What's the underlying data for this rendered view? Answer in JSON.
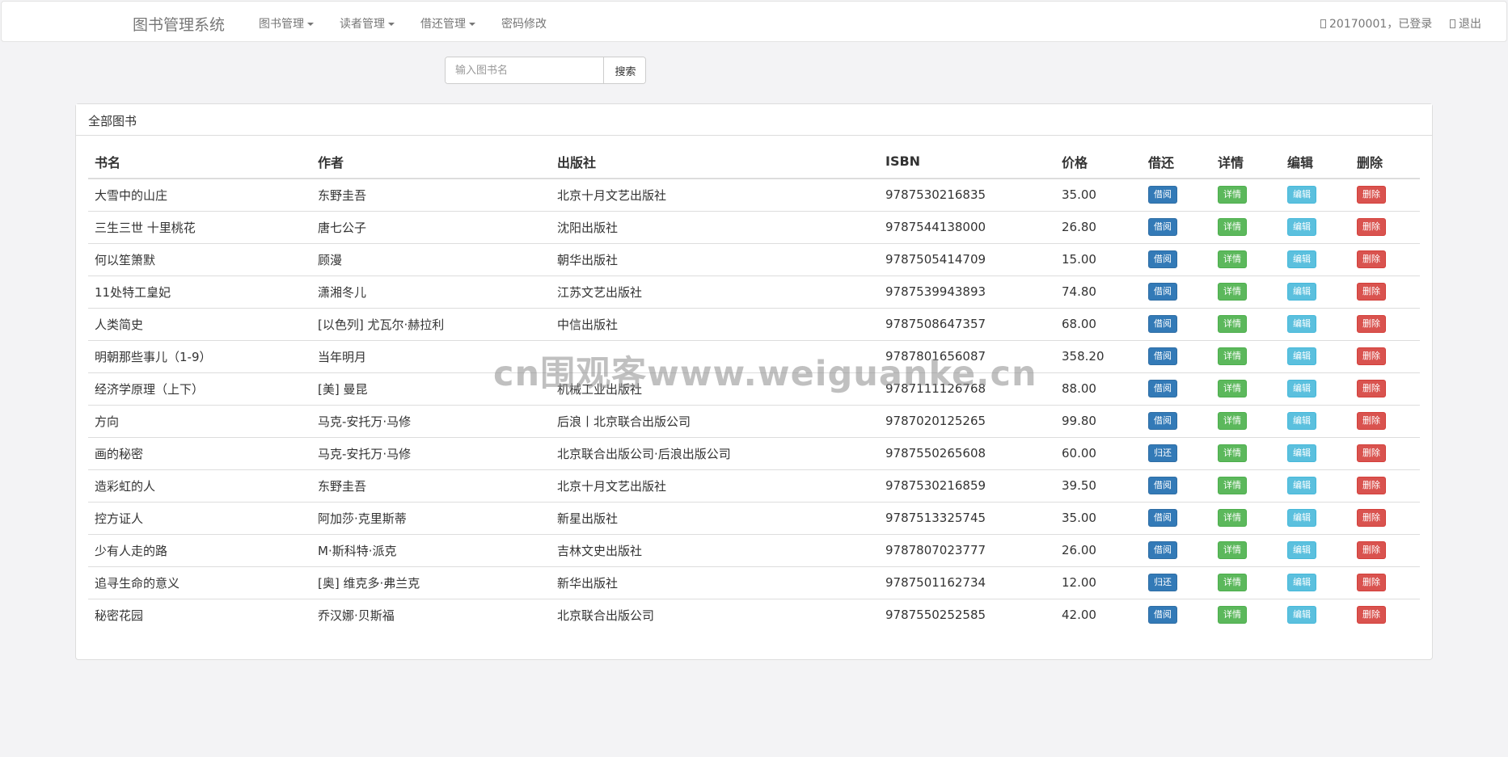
{
  "nav": {
    "brand": "图书管理系统",
    "items": [
      {
        "label": "图书管理",
        "dropdown": true
      },
      {
        "label": "读者管理",
        "dropdown": true
      },
      {
        "label": "借还管理",
        "dropdown": true
      },
      {
        "label": "密码修改",
        "dropdown": false
      }
    ],
    "user": "20170001，已登录",
    "logout": "退出"
  },
  "search": {
    "placeholder": "输入图书名",
    "button": "搜索"
  },
  "panel": {
    "title": "全部图书"
  },
  "table": {
    "headers": [
      "书名",
      "作者",
      "出版社",
      "ISBN",
      "价格",
      "借还",
      "详情",
      "编辑",
      "删除"
    ],
    "rows": [
      {
        "name": "大雪中的山庄",
        "author": "东野圭吾",
        "publisher": "北京十月文艺出版社",
        "isbn": "9787530216835",
        "price": "35.00",
        "action": "借阅"
      },
      {
        "name": "三生三世 十里桃花",
        "author": "唐七公子",
        "publisher": "沈阳出版社",
        "isbn": "9787544138000",
        "price": "26.80",
        "action": "借阅"
      },
      {
        "name": "何以笙箫默",
        "author": "顾漫",
        "publisher": "朝华出版社",
        "isbn": "9787505414709",
        "price": "15.00",
        "action": "借阅"
      },
      {
        "name": "11处特工皇妃",
        "author": "潇湘冬儿",
        "publisher": "江苏文艺出版社",
        "isbn": "9787539943893",
        "price": "74.80",
        "action": "借阅"
      },
      {
        "name": "人类简史",
        "author": "[以色列] 尤瓦尔·赫拉利",
        "publisher": "中信出版社",
        "isbn": "9787508647357",
        "price": "68.00",
        "action": "借阅"
      },
      {
        "name": "明朝那些事儿（1-9）",
        "author": "当年明月",
        "publisher": "",
        "isbn": "9787801656087",
        "price": "358.20",
        "action": "借阅"
      },
      {
        "name": "经济学原理（上下）",
        "author": "[美] 曼昆",
        "publisher": "机械工业出版社",
        "isbn": "9787111126768",
        "price": "88.00",
        "action": "借阅"
      },
      {
        "name": "方向",
        "author": "马克-安托万·马修",
        "publisher": "后浪丨北京联合出版公司",
        "isbn": "9787020125265",
        "price": "99.80",
        "action": "借阅"
      },
      {
        "name": "画的秘密",
        "author": "马克-安托万·马修",
        "publisher": "北京联合出版公司·后浪出版公司",
        "isbn": "9787550265608",
        "price": "60.00",
        "action": "归还"
      },
      {
        "name": "造彩虹的人",
        "author": "东野圭吾",
        "publisher": "北京十月文艺出版社",
        "isbn": "9787530216859",
        "price": "39.50",
        "action": "借阅"
      },
      {
        "name": "控方证人",
        "author": "阿加莎·克里斯蒂",
        "publisher": "新星出版社",
        "isbn": "9787513325745",
        "price": "35.00",
        "action": "借阅"
      },
      {
        "name": "少有人走的路",
        "author": "M·斯科特·派克",
        "publisher": "吉林文史出版社",
        "isbn": "9787807023777",
        "price": "26.00",
        "action": "借阅"
      },
      {
        "name": "追寻生命的意义",
        "author": "[奥] 维克多·弗兰克",
        "publisher": "新华出版社",
        "isbn": "9787501162734",
        "price": "12.00",
        "action": "归还"
      },
      {
        "name": "秘密花园",
        "author": "乔汉娜·贝斯福",
        "publisher": "北京联合出版公司",
        "isbn": "9787550252585",
        "price": "42.00",
        "action": "借阅"
      }
    ],
    "detail_label": "详情",
    "edit_label": "编辑",
    "delete_label": "删除"
  },
  "watermark": "cn围观客www.weiguanke.cn",
  "colors": {
    "primary": "#337ab7",
    "success": "#5cb85c",
    "info": "#5bc0de",
    "danger": "#d9534f"
  }
}
